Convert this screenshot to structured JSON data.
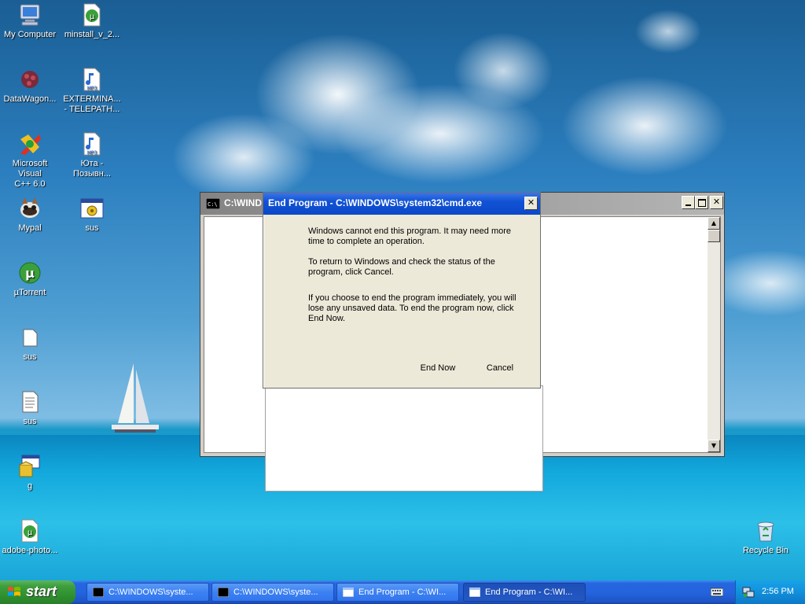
{
  "desktop_icons": [
    {
      "label": "My Computer",
      "icon": "my-computer-icon"
    },
    {
      "label": "minstall_v_2...",
      "icon": "utorrent-file-icon"
    },
    {
      "label": "DataWagon...",
      "icon": "datawagon-icon"
    },
    {
      "label": "EXTERMINA...\n- TELEPATH...",
      "icon": "mp3-file-icon"
    },
    {
      "label": "Microsoft Visual\nC++ 6.0",
      "icon": "visual-cpp-icon"
    },
    {
      "label": "Юта -\nПозывн...",
      "icon": "mp3-file-icon"
    },
    {
      "label": "Mypal",
      "icon": "mypal-browser-icon"
    },
    {
      "label": "sus",
      "icon": "batch-file-icon"
    },
    {
      "label": "µTorrent",
      "icon": "utorrent-icon"
    },
    {
      "label": "sus",
      "icon": "blank-file-icon"
    },
    {
      "label": "sus",
      "icon": "text-file-icon"
    },
    {
      "label": "g",
      "icon": "installer-icon"
    },
    {
      "label": "adobe-photo...",
      "icon": "utorrent-file-icon"
    },
    {
      "label": "Recycle Bin",
      "icon": "recycle-bin-icon"
    }
  ],
  "cmd_window": {
    "title": "C:\\WINDOWS\\system32\\cmd.exe",
    "title_visible": "C:\\WIND"
  },
  "dialog": {
    "title": "End Program - C:\\WINDOWS\\system32\\cmd.exe",
    "paragraph1": "Windows cannot end this program. It may need more time to complete an operation.",
    "paragraph2": "To return to Windows and check the status of the program, click Cancel.",
    "paragraph3": "If you choose to end the program immediately, you will lose any unsaved data. To end the program now, click End Now.",
    "end_now_label": "End Now",
    "cancel_label": "Cancel",
    "close_glyph": "✕"
  },
  "taskbar": {
    "start_label": "start",
    "tasks": [
      {
        "label": "C:\\WINDOWS\\syste...",
        "icon": "cmd-icon",
        "active": false
      },
      {
        "label": "C:\\WINDOWS\\syste...",
        "icon": "cmd-icon",
        "active": false
      },
      {
        "label": "End Program - C:\\WI...",
        "icon": "window-icon",
        "active": false
      },
      {
        "label": "End Program - C:\\WI...",
        "icon": "window-icon",
        "active": true
      }
    ],
    "clock": "2:56 PM"
  },
  "colors": {
    "titlebar_active": "#0b48c8",
    "taskbar": "#2464de",
    "start_green": "#3c9e3c",
    "dialog_face": "#ece9d8"
  }
}
